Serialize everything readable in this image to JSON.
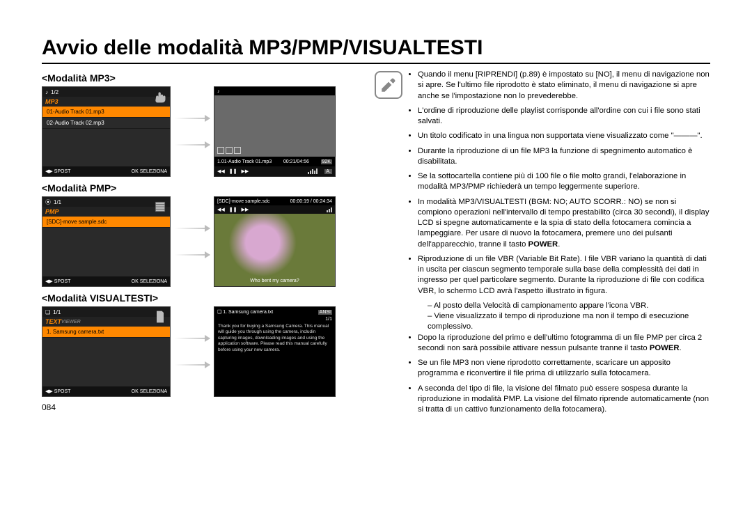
{
  "page_title": "Avvio delle modalità MP3/PMP/VISUALTESTI",
  "page_number": "084",
  "modes": {
    "mp3": {
      "label": "<Modalità MP3>",
      "header_count": "1/2",
      "mode_name": "MP3",
      "items": [
        "01-Audio Track 01.mp3",
        "02-Audio Track 02.mp3"
      ],
      "footer_left": "SPOST",
      "footer_right": "OK  SELEZIONA",
      "play_title": "1.01-Audio Track 01.mp3",
      "play_time": "00:21/04:56",
      "play_bitrate": "92K",
      "play_badge": "A."
    },
    "pmp": {
      "label": "<Modalità PMP>",
      "header_count": "1/1",
      "mode_name": "PMP",
      "items": [
        "[SDC]-move sample.sdc"
      ],
      "footer_left": "SPOST",
      "footer_right": "OK  SELEZIONA",
      "overlay_file": "[SDC]-move sample.sdc",
      "overlay_time": "00:00:19 / 00:24:34",
      "caption": "Who bent my camera?"
    },
    "text": {
      "label": "<Modalità VISUALTESTI>",
      "header_count": "1/1",
      "mode_name": "TEXT",
      "mode_sub": "VIEWER",
      "items": [
        "1. Samsung camera.txt"
      ],
      "footer_left": "SPOST",
      "footer_right": "OK  SELEZIONA",
      "view_header": "1. Samsung camera.txt",
      "view_page": "1/1",
      "view_badge": "ANSI",
      "view_body": "Thank you for buying a Samsung Camera. This manual will guide you through using the camera, includin capturing images, downloading images and using the application software. Please read this manual carefully before using your new camera."
    }
  },
  "notes": [
    "Quando il menu [RIPRENDI] (p.89) è impostato su [NO], il menu di navigazione non si apre. Se l'ultimo file riprodotto è stato eliminato, il menu di navigazione si apre anche se l'impostazione non lo prevederebbe.",
    "L'ordine di riproduzione delle playlist corrisponde all'ordine con cui i file sono stati salvati.",
    "Un titolo codificato in una lingua non supportata viene visualizzato come \"———\".",
    "Durante la riproduzione di un file MP3 la funzione di spegnimento automatico è disabilitata.",
    "Se la sottocartella contiene più di 100 file o file molto grandi, l'elaborazione in modalità MP3/PMP richiederà un tempo leggermente superiore.",
    "In modalità MP3/VISUALTESTI (BGM: NO; AUTO SCORR.: NO) se non si compiono operazioni nell'intervallo di tempo prestabilito (circa 30 secondi), il display LCD si spegne automaticamente e la spia di stato della fotocamera comincia a lampeggiare. Per usare di nuovo la fotocamera, premere uno dei pulsanti dell'apparecchio, tranne il tasto <b>POWER</b>.",
    "Riproduzione di un file VBR (Variable Bit Rate). I file VBR variano la quantità di dati in uscita per ciascun segmento temporale sulla base della complessità dei dati in ingresso per quel particolare segmento. Durante la riproduzione di file con codifica VBR, lo schermo LCD avrà l'aspetto illustrato in figura.",
    "Dopo la riproduzione del primo e dell'ultimo fotogramma di un file PMP per circa 2 secondi non sarà possibile attivare nessun pulsante tranne il tasto <b>POWER</b>.",
    "Se un file MP3 non viene riprodotto correttamente, scaricare un apposito programma e riconvertire il file prima di utilizzarlo sulla fotocamera.",
    "A seconda del tipo di file, la visione del filmato può essere sospesa durante la riproduzione in modalità PMP. La visione del filmato riprende automaticamente (non si tratta di un cattivo funzionamento della fotocamera)."
  ],
  "sub_notes": [
    "Al posto della Velocità di campionamento appare l'icona VBR.",
    "Viene visualizzato il tempo di riproduzione ma non il tempo di esecuzione complessivo."
  ]
}
